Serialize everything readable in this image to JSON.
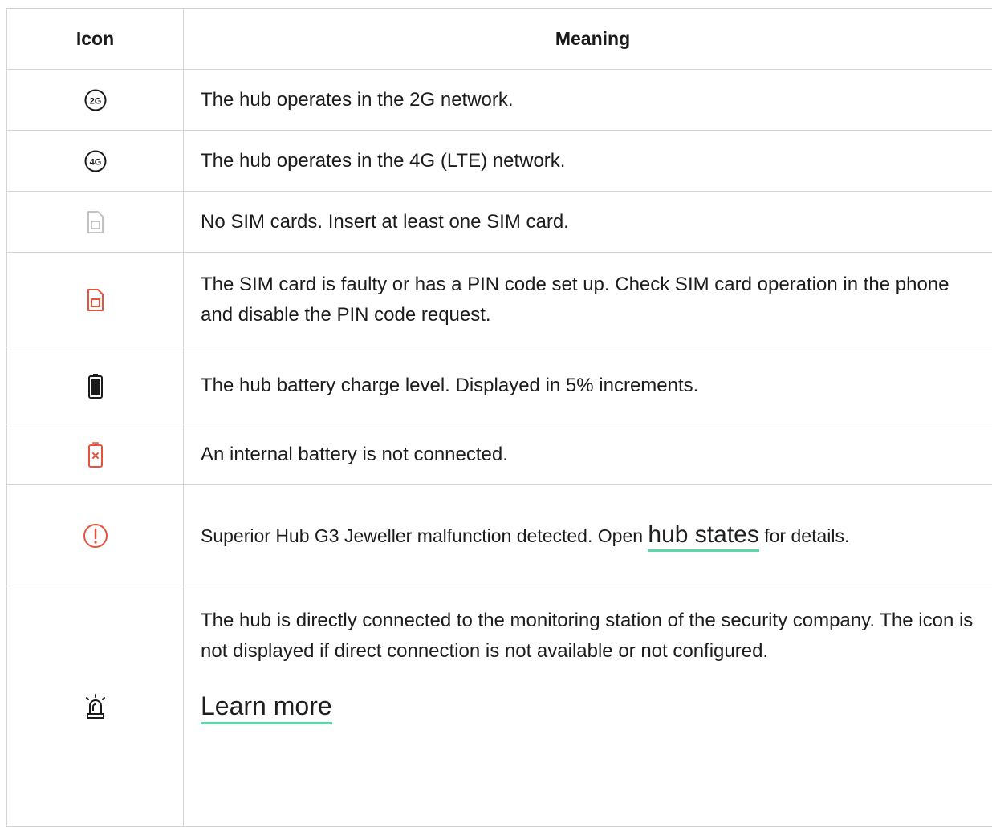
{
  "table": {
    "headers": {
      "icon": "Icon",
      "meaning": "Meaning"
    },
    "rows": {
      "r2g": {
        "icon": "2g-network-icon",
        "badge": "2G",
        "text": "The hub operates in the 2G network."
      },
      "r4g": {
        "icon": "4g-network-icon",
        "badge": "4G",
        "text": "The hub operates in the 4G (LTE) network."
      },
      "rnosim": {
        "icon": "sim-card-empty-icon",
        "text": "No SIM cards. Insert at least one SIM card."
      },
      "rfaulty": {
        "icon": "sim-card-faulty-icon",
        "text": "The SIM card is faulty or has a PIN code set up. Check SIM card operation in the phone and disable the PIN code request."
      },
      "rbattery": {
        "icon": "battery-icon",
        "text": "The hub battery charge level. Displayed in 5% increments."
      },
      "rnobattery": {
        "icon": "battery-missing-icon",
        "text": "An internal battery is not connected."
      },
      "rmalfunction": {
        "icon": "warning-icon",
        "text_before": "Superior Hub G3 Jeweller malfunction detected. Open ",
        "link": "hub states",
        "text_after": " for details."
      },
      "rmonitoring": {
        "icon": "siren-icon",
        "text": "The hub is directly connected to the monitoring station of the security company. The icon is not displayed if direct connection is not available or not configured.",
        "link": "Learn more"
      }
    }
  },
  "colors": {
    "border": "#d4d4d4",
    "alert_red": "#e5533d",
    "inactive_grey": "#c4c4c4",
    "link_underline": "#5ed6a8"
  }
}
